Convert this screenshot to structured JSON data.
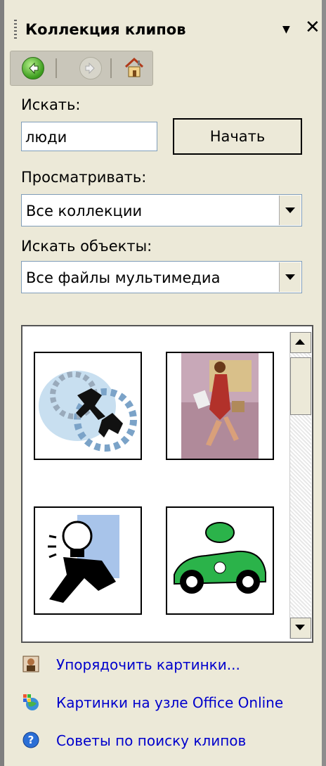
{
  "pane": {
    "title": "Коллекция клипов",
    "menu_icon": "dropdown-arrow",
    "close_icon": "x"
  },
  "nav": {
    "back_icon": "back-arrow-icon",
    "forward_icon": "forward-arrow-icon",
    "home_icon": "home-icon"
  },
  "search": {
    "label": "Искать:",
    "value": "люди",
    "button_label": "Начать"
  },
  "browse": {
    "label": "Просматривать:",
    "selected": "Все коллекции"
  },
  "object_type": {
    "label": "Искать объекты:",
    "selected": "Все файлы мультимедиа"
  },
  "results": {
    "items": [
      {
        "icon": "businessmen-gears-clipart"
      },
      {
        "icon": "woman-walking-clipart"
      },
      {
        "icon": "man-lightbulb-clipart"
      },
      {
        "icon": "green-race-car-clipart"
      }
    ]
  },
  "links": [
    {
      "label": "Упорядочить картинки...",
      "icon": "organizer-icon"
    },
    {
      "label": "Картинки на узле Office Online",
      "icon": "office-online-icon"
    },
    {
      "label": "Советы по поиску клипов",
      "icon": "help-icon"
    }
  ]
}
